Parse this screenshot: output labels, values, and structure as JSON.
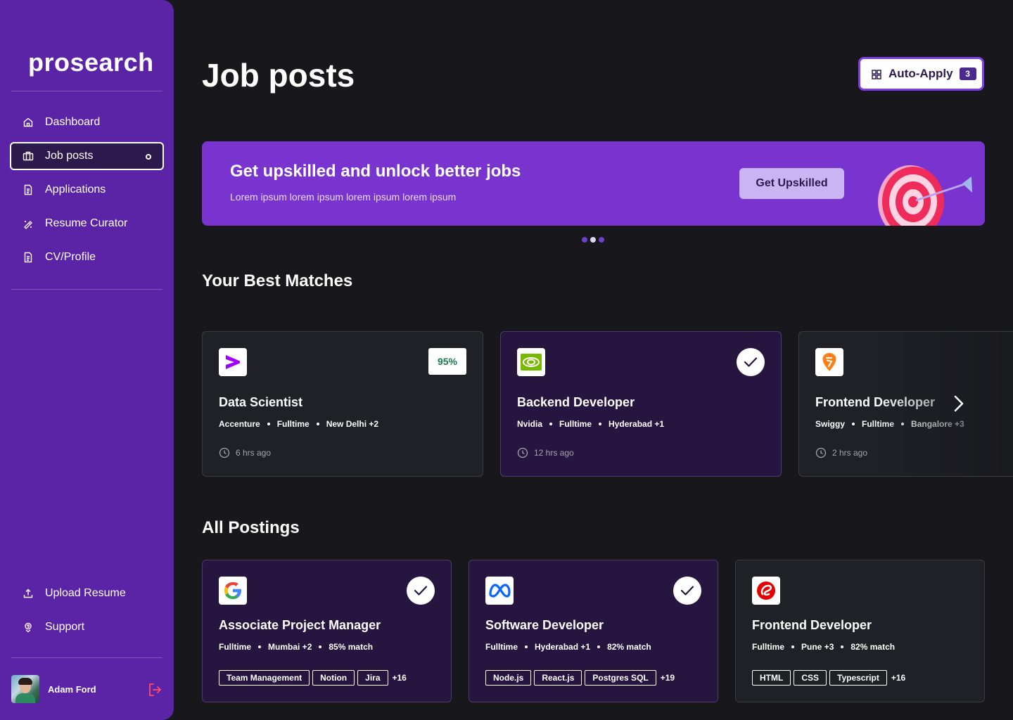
{
  "app": {
    "name": "prosearch"
  },
  "sidebar": {
    "nav": [
      {
        "label": "Dashboard",
        "icon": "home-icon"
      },
      {
        "label": "Job posts",
        "icon": "briefcase-icon",
        "active": true
      },
      {
        "label": "Applications",
        "icon": "document-icon"
      },
      {
        "label": "Resume Curator",
        "icon": "sparkle-pen-icon"
      },
      {
        "label": "CV/Profile",
        "icon": "document-icon"
      }
    ],
    "bottom": [
      {
        "label": "Upload Resume",
        "icon": "upload-icon"
      },
      {
        "label": "Support",
        "icon": "support-icon"
      }
    ],
    "user": {
      "name": "Adam Ford"
    }
  },
  "header": {
    "title": "Job posts",
    "auto_apply": {
      "label": "Auto-Apply",
      "count": "3"
    }
  },
  "banner": {
    "title": "Get upskilled and unlock better jobs",
    "subtitle": "Lorem ipsum lorem ipsum lorem ipsum lorem ipsum",
    "button": "Get Upskilled",
    "slides": 3,
    "active_slide": 2
  },
  "best_matches": {
    "title": "Your Best Matches",
    "cards": [
      {
        "title": "Data Scientist",
        "company": "Accenture",
        "type": "Fulltime",
        "location": "New Delhi +2",
        "time": "6 hrs ago",
        "match": "95%",
        "applied": false,
        "logo": "accenture-logo"
      },
      {
        "title": "Backend Developer",
        "company": "Nvidia",
        "type": "Fulltime",
        "location": "Hyderabad +1",
        "time": "12 hrs ago",
        "applied": true,
        "logo": "nvidia-logo"
      },
      {
        "title": "Frontend Developer",
        "company": "Swiggy",
        "type": "Fulltime",
        "location": "Bangalore +3",
        "time": "2 hrs ago",
        "applied": false,
        "logo": "swiggy-logo"
      }
    ]
  },
  "all_postings": {
    "title": "All Postings",
    "cards": [
      {
        "title": "Associate Project Manager",
        "type": "Fulltime",
        "location": "Mumbai +2",
        "match": "85% match",
        "tags": [
          "Team Management",
          "Notion",
          "Jira"
        ],
        "more": "+16",
        "applied": true,
        "logo": "google-logo"
      },
      {
        "title": "Software Developer",
        "type": "Fulltime",
        "location": "Hyderabad +1",
        "match": "82% match",
        "tags": [
          "Node.js",
          "React.js",
          "Postgres SQL"
        ],
        "more": "+19",
        "applied": true,
        "logo": "meta-logo"
      },
      {
        "title": "Frontend Developer",
        "type": "Fulltime",
        "location": "Pune +3",
        "match": "82% match",
        "tags": [
          "HTML",
          "CSS",
          "Typescript"
        ],
        "more": "+16",
        "applied": false,
        "logo": "airtel-logo"
      }
    ]
  },
  "colors": {
    "sidebar": "#5b24a6",
    "background": "#18181c",
    "banner": "#7934d0",
    "accent": "#7b3fe4"
  }
}
